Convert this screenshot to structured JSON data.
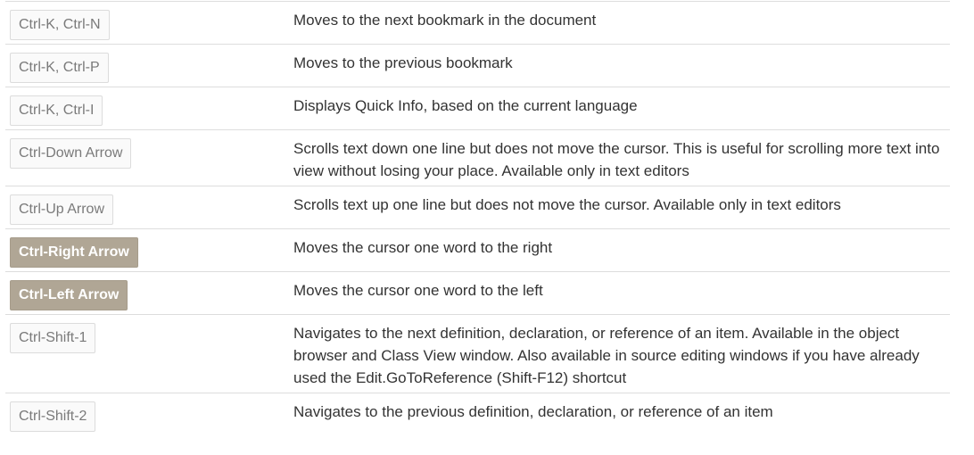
{
  "shortcuts": [
    {
      "key": "Ctrl-K, Ctrl-N",
      "description": "Moves to the next bookmark in the document",
      "highlighted": false
    },
    {
      "key": "Ctrl-K, Ctrl-P",
      "description": "Moves to the previous bookmark",
      "highlighted": false
    },
    {
      "key": "Ctrl-K, Ctrl-I",
      "description": "Displays Quick Info, based on the current language",
      "highlighted": false
    },
    {
      "key": "Ctrl-Down Arrow",
      "description": "Scrolls text down one line but does not move the cursor. This is useful for scrolling more text into view without losing your place. Available only in text editors",
      "highlighted": false
    },
    {
      "key": "Ctrl-Up Arrow",
      "description": "Scrolls text up one line but does not move the cursor. Available only in text editors",
      "highlighted": false
    },
    {
      "key": "Ctrl-Right Arrow",
      "description": "Moves the cursor one word to the right",
      "highlighted": true
    },
    {
      "key": "Ctrl-Left Arrow",
      "description": "Moves the cursor one word to the left",
      "highlighted": true
    },
    {
      "key": "Ctrl-Shift-1",
      "description": "Navigates to the next definition, declaration, or reference of an item. Available in the object browser and Class View window. Also available in source editing windows if you have already used the Edit.GoToReference (Shift-F12) shortcut",
      "highlighted": false
    },
    {
      "key": "Ctrl-Shift-2",
      "description": "Navigates to the previous definition, declaration, or reference of an item",
      "highlighted": false
    }
  ],
  "colors": {
    "highlight_bg": "#b0a695",
    "key_text": "#7a7a7a",
    "row_border": "#dddddd"
  }
}
